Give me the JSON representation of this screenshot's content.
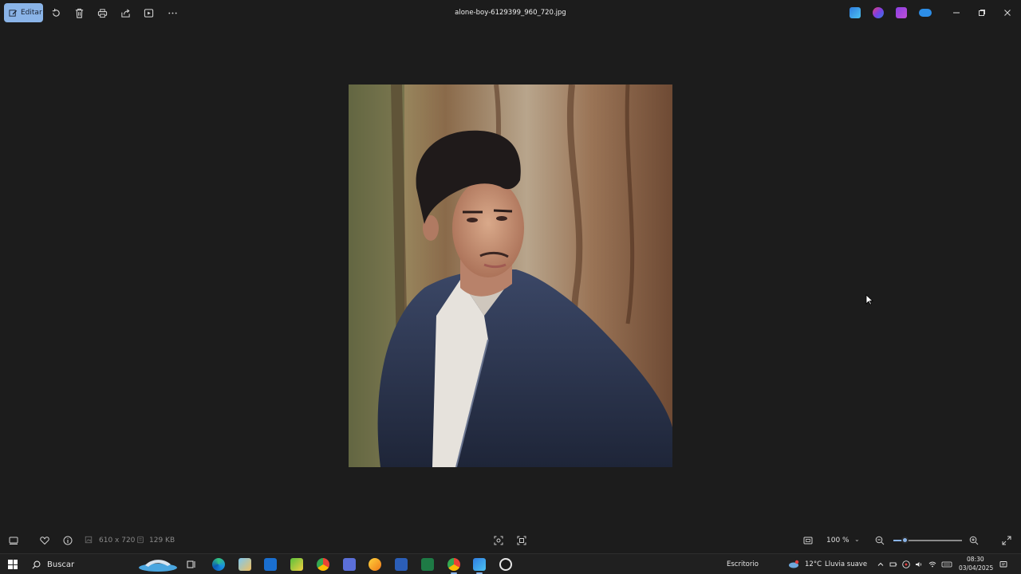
{
  "toolbar": {
    "edit_label": "Editar",
    "icons": [
      "rotate-icon",
      "delete-icon",
      "print-icon",
      "share-icon",
      "slideshow-icon",
      "more-icon"
    ]
  },
  "window": {
    "title": "alone-boy-6129399_960_720.jpg",
    "controls": [
      "minimize-icon",
      "maximize-icon",
      "close-icon"
    ]
  },
  "header_apps": [
    "clipchamp-icon",
    "copilot-icon",
    "clipchamp-video-icon",
    "onedrive-icon"
  ],
  "image_info": {
    "dimensions": "610 x 720",
    "size": "129 KB"
  },
  "zoom": {
    "value": "100 %",
    "level": 0.15
  },
  "taskbar": {
    "search_label": "Buscar",
    "desktop_label": "Escritorio",
    "weather_temp": "12°C",
    "weather_desc": "Lluvia suave",
    "time": "08:30",
    "date": "03/04/2025"
  },
  "colors": {
    "accent": "#8ab4e8",
    "background": "#1c1c1c",
    "taskbar": "#202020"
  }
}
